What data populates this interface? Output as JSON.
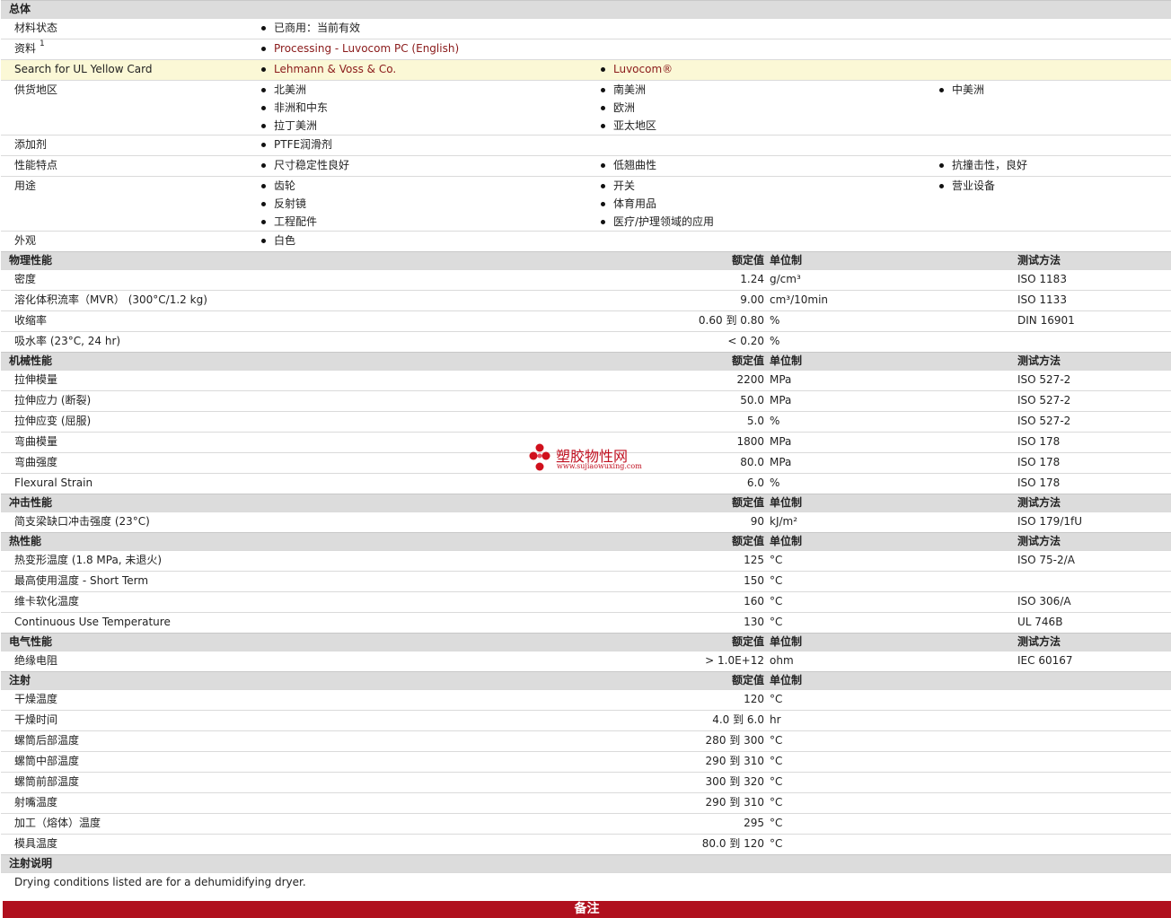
{
  "general": {
    "title": "总体",
    "rows": [
      {
        "label": "材料状态",
        "items": [
          "已商用：当前有效"
        ]
      },
      {
        "label": "资料",
        "sup": "1",
        "items": [
          "Processing - Luvocom PC (English)"
        ],
        "link": true
      },
      {
        "label": "Search for UL Yellow Card",
        "items": [
          "Lehmann & Voss & Co.",
          "Luvocom®"
        ],
        "link": true,
        "highlight": true
      },
      {
        "label": "供货地区",
        "items": [
          "北美洲",
          "南美洲",
          "中美洲",
          "非洲和中东",
          "欧洲",
          "",
          "拉丁美洲",
          "亚太地区",
          ""
        ]
      },
      {
        "label": "添加剂",
        "items": [
          "PTFE润滑剂"
        ]
      },
      {
        "label": "性能特点",
        "items": [
          "尺寸稳定性良好",
          "低翘曲性",
          "抗撞击性，良好"
        ]
      },
      {
        "label": "用途",
        "items": [
          "齿轮",
          "开关",
          "营业设备",
          "反射镜",
          "体育用品",
          "",
          "工程配件",
          "医疗/护理领域的应用",
          ""
        ]
      },
      {
        "label": "外观",
        "items": [
          "白色"
        ]
      }
    ]
  },
  "sections": [
    {
      "title": "物理性能",
      "h_val": "额定值",
      "h_unit": "单位制",
      "h_test": "测试方法",
      "rows": [
        {
          "label": "密度",
          "val": "1.24",
          "unit": "g/cm³",
          "test": "ISO 1183"
        },
        {
          "label": "溶化体积流率（MVR） (300°C/1.2 kg)",
          "val": "9.00",
          "unit": "cm³/10min",
          "test": "ISO 1133"
        },
        {
          "label": "收缩率",
          "val": "0.60 到  0.80",
          "unit": "%",
          "test": "DIN 16901"
        },
        {
          "label": "吸水率 (23°C, 24 hr)",
          "val": "< 0.20",
          "unit": "%",
          "test": ""
        }
      ]
    },
    {
      "title": "机械性能",
      "h_val": "额定值",
      "h_unit": "单位制",
      "h_test": "测试方法",
      "rows": [
        {
          "label": "拉伸模量",
          "val": "2200",
          "unit": "MPa",
          "test": "ISO 527-2"
        },
        {
          "label": "拉伸应力 (断裂)",
          "val": "50.0",
          "unit": "MPa",
          "test": "ISO 527-2"
        },
        {
          "label": "拉伸应变 (屈服)",
          "val": "5.0",
          "unit": "%",
          "test": "ISO 527-2"
        },
        {
          "label": "弯曲模量",
          "val": "1800",
          "unit": "MPa",
          "test": "ISO 178"
        },
        {
          "label": "弯曲强度",
          "val": "80.0",
          "unit": "MPa",
          "test": "ISO 178"
        },
        {
          "label": "Flexural Strain",
          "val": "6.0",
          "unit": "%",
          "test": "ISO 178"
        }
      ]
    },
    {
      "title": "冲击性能",
      "h_val": "额定值",
      "h_unit": "单位制",
      "h_test": "测试方法",
      "rows": [
        {
          "label": "简支梁缺口冲击强度 (23°C)",
          "val": "90",
          "unit": "kJ/m²",
          "test": "ISO 179/1fU"
        }
      ]
    },
    {
      "title": "热性能",
      "h_val": "额定值",
      "h_unit": "单位制",
      "h_test": "测试方法",
      "rows": [
        {
          "label": "热变形温度 (1.8 MPa, 未退火)",
          "val": "125",
          "unit": "°C",
          "test": "ISO 75-2/A"
        },
        {
          "label": "最高使用温度 - Short Term",
          "val": "150",
          "unit": "°C",
          "test": ""
        },
        {
          "label": "维卡软化温度",
          "val": "160",
          "unit": "°C",
          "test": "ISO 306/A"
        },
        {
          "label": "Continuous Use Temperature",
          "val": "130",
          "unit": "°C",
          "test": "UL 746B"
        }
      ]
    },
    {
      "title": "电气性能",
      "h_val": "额定值",
      "h_unit": "单位制",
      "h_test": "测试方法",
      "rows": [
        {
          "label": "绝缘电阻",
          "val": "> 1.0E+12",
          "unit": "ohm",
          "test": "IEC 60167"
        }
      ]
    },
    {
      "title": "注射",
      "h_val": "额定值",
      "h_unit": "单位制",
      "h_test": "",
      "rows": [
        {
          "label": "干燥温度",
          "val": "120",
          "unit": "°C",
          "test": ""
        },
        {
          "label": "干燥时间",
          "val": "4.0 到  6.0",
          "unit": "hr",
          "test": ""
        },
        {
          "label": "螺筒后部温度",
          "val": "280 到  300",
          "unit": "°C",
          "test": ""
        },
        {
          "label": "螺筒中部温度",
          "val": "290 到  310",
          "unit": "°C",
          "test": ""
        },
        {
          "label": "螺筒前部温度",
          "val": "300 到  320",
          "unit": "°C",
          "test": ""
        },
        {
          "label": "射嘴温度",
          "val": "290 到  310",
          "unit": "°C",
          "test": ""
        },
        {
          "label": "加工（熔体）温度",
          "val": "295",
          "unit": "°C",
          "test": ""
        },
        {
          "label": "模具温度",
          "val": "80.0 到  120",
          "unit": "°C",
          "test": ""
        }
      ]
    }
  ],
  "notes": {
    "title": "注射说明",
    "text": "Drying conditions listed are for a dehumidifying dryer."
  },
  "footer": {
    "label": "备注"
  },
  "watermark": {
    "name": "塑胶物性网",
    "url": "www.sujiaowuxing.com"
  },
  "colors": {
    "link": "#8a1a1a",
    "section_bg": "#dcdcdc",
    "highlight": "#fbf8d6",
    "footer": "#b0101e"
  }
}
